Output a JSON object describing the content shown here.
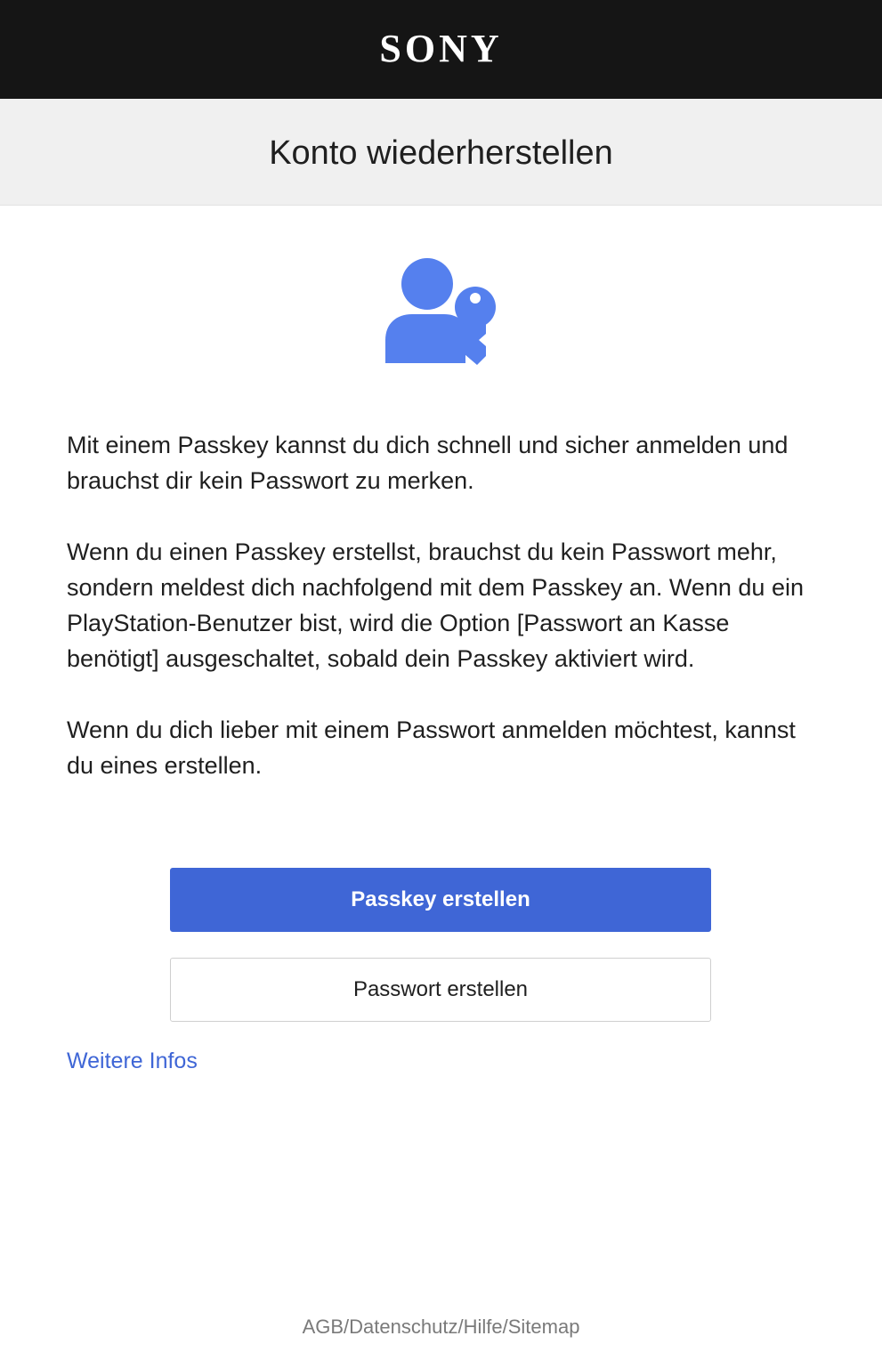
{
  "header": {
    "logo_text": "SONY"
  },
  "page": {
    "title": "Konto wiederherstellen"
  },
  "icon": {
    "name": "user-key-icon",
    "color": "#5580ee"
  },
  "content": {
    "paragraph_1": "Mit einem Passkey kannst du dich schnell und sicher anmelden und brauchst dir kein Passwort zu merken.",
    "paragraph_2": "Wenn du einen Passkey erstellst, brauchst du kein Passwort mehr, sondern meldest dich nachfolgend mit dem Passkey an. Wenn du ein PlayStation-Benutzer bist, wird die Option [Passwort an Kasse benötigt] ausgeschaltet, sobald dein Passkey aktiviert wird.",
    "paragraph_3": "Wenn du dich lieber mit einem Passwort anmelden möchtest, kannst du eines erstellen."
  },
  "actions": {
    "primary_label": "Passkey erstellen",
    "secondary_label": "Passwort erstellen",
    "more_info_label": "Weitere Infos"
  },
  "footer": {
    "links": [
      "AGB",
      "Datenschutz",
      "Hilfe",
      "Sitemap"
    ],
    "separator": "/"
  },
  "colors": {
    "header_bg": "#151515",
    "title_bar_bg": "#f0f0f0",
    "accent": "#3f66d6"
  }
}
